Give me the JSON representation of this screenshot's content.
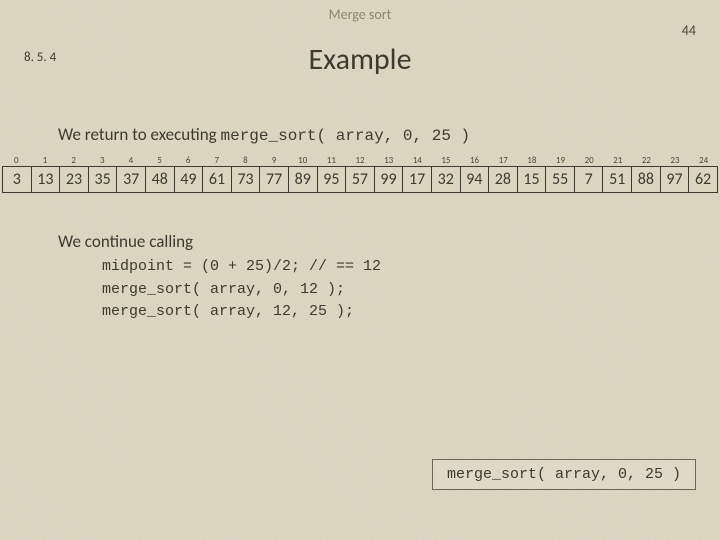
{
  "header": {
    "topic": "Merge sort",
    "slide_number": "44",
    "section": "8. 5. 4",
    "title": "Example"
  },
  "body": {
    "line1_prefix": "We return to executing ",
    "line1_code": "merge_sort( array, 0, 25 )",
    "indices": [
      "0",
      "1",
      "2",
      "3",
      "4",
      "5",
      "6",
      "7",
      "8",
      "9",
      "10",
      "11",
      "12",
      "13",
      "14",
      "15",
      "16",
      "17",
      "18",
      "19",
      "20",
      "21",
      "22",
      "23",
      "24"
    ],
    "values": [
      "3",
      "13",
      "23",
      "35",
      "37",
      "48",
      "49",
      "61",
      "73",
      "77",
      "89",
      "95",
      "57",
      "99",
      "17",
      "32",
      "94",
      "28",
      "15",
      "55",
      "7",
      "51",
      "88",
      "97",
      "62"
    ],
    "continue_text": "We continue calling",
    "code_lines": [
      "midpoint = (0 + 25)/2; // == 12",
      "merge_sort( array, 0, 12 );",
      "merge_sort( array, 12, 25 );"
    ],
    "callframe": "merge_sort( array,  0, 25 )"
  }
}
